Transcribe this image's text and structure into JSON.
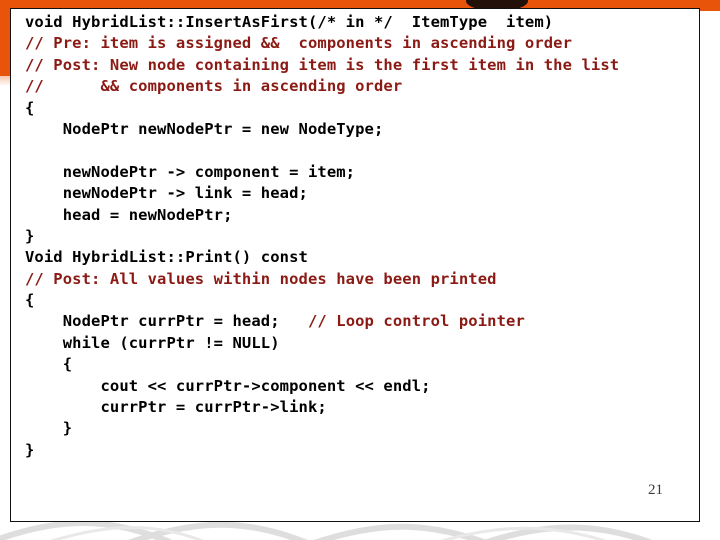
{
  "slide": {
    "number": "21",
    "accent_color": "#E8540A",
    "comment_color": "#8B1A14",
    "code_color": "#000000",
    "background_color": "#FFFFFF",
    "border_color": "#111111"
  },
  "code": {
    "lines": [
      {
        "kind": "code",
        "text": "void HybridList::InsertAsFirst(/* in */  ItemType  item)"
      },
      {
        "kind": "comment",
        "text": "// Pre: item is assigned &&  components in ascending order"
      },
      {
        "kind": "comment",
        "text": "// Post: New node containing item is the first item in the list"
      },
      {
        "kind": "comment",
        "text": "//      && components in ascending order"
      },
      {
        "kind": "code",
        "text": "{"
      },
      {
        "kind": "code",
        "text": "    NodePtr newNodePtr = new NodeType;"
      },
      {
        "kind": "blank",
        "text": ""
      },
      {
        "kind": "code",
        "text": "    newNodePtr -> component = item;"
      },
      {
        "kind": "code",
        "text": "    newNodePtr -> link = head;"
      },
      {
        "kind": "code",
        "text": "    head = newNodePtr;"
      },
      {
        "kind": "code",
        "text": "}"
      },
      {
        "kind": "code",
        "text": "Void HybridList::Print() const"
      },
      {
        "kind": "comment",
        "text": "// Post: All values within nodes have been printed"
      },
      {
        "kind": "code",
        "text": "{"
      },
      {
        "kind": "mixed",
        "code": "    NodePtr currPtr = head;   ",
        "comment": "// Loop control pointer"
      },
      {
        "kind": "code",
        "text": "    while (currPtr != NULL)"
      },
      {
        "kind": "code",
        "text": "    {"
      },
      {
        "kind": "code",
        "text": "        cout << currPtr->component << endl;"
      },
      {
        "kind": "code",
        "text": "        currPtr = currPtr->link;"
      },
      {
        "kind": "code",
        "text": "    }"
      },
      {
        "kind": "code",
        "text": "}"
      }
    ]
  }
}
